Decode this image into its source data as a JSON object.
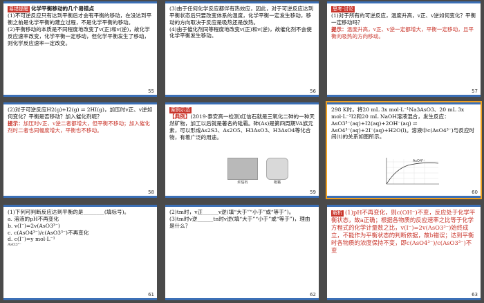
{
  "slides": [
    {
      "number": "55",
      "tag": "易错提醒",
      "title": "化学平衡移动的几个易错点",
      "lines": [
        "(1)不可逆反应只有达到平衡后才会有平衡的移动，在没达到平衡之前是化学平衡的建立过程，不是化学平衡的移动。",
        "(2)平衡移动的本质是不同程度地改变了v(正)和v(逆)，故化学反应速率改变，化学平衡一定移动，但化学平衡发生了移动，则化学反应速率一定改变。"
      ]
    },
    {
      "number": "56",
      "lines": [
        "(3)由于任何化学反应都伴有热效应，因此，对于可逆反应达到平衡状态后只要改变体系的温度，化学平衡一定发生移动，移动的方向取决于反应是吸热还是放热。",
        "(4)由于催化剂同等程度地改变v(正)和v(逆)，故催化剂不会使化学平衡发生移动。"
      ]
    },
    {
      "number": "57",
      "tag": "思考·讨论",
      "q": "(1)对于所有的可逆反应，温度升高，v正、v逆如何变化？平衡一定移动吗？",
      "hint_label": "提示：",
      "a": "温度升高，v正、v逆一定都增大，平衡一定移动，且平衡向吸热的方向移动。"
    },
    {
      "number": "58",
      "q": "(2)对于可逆反应H2(g)+I2(g) ⇌ 2HI(g)，加压时v正、v逆如何变化？平衡是否移动？加入催化剂呢？",
      "hint_label": "提示：",
      "a": "加压时v正、v逆二者都增大，但平衡不移动；加入催化剂时二者也同幅度增大，平衡也不移动。"
    },
    {
      "number": "59",
      "tag": "案例示范",
      "case_label": "【典例】",
      "text": "(2019·泰安高一检测)红信石就是三氧化二砷的一种天然矿物，加工以后就是著名的砒霜。砷(As)是第四周期VA族元素，可以形成As2S3、As2O5、H3AsO3、H3AsO4等化合物，有着广泛的用途。",
      "cap1": "红信石",
      "cap2": "砒霜"
    },
    {
      "number": "60",
      "text": "298 K时，将20 mL 3x mol·L⁻¹Na3AsO3、20 mL 3x mol·L⁻¹I2和20 mL NaOH溶液混合，发生反应：AsO3³⁻(aq)+I2(aq)+2OH⁻(aq) ⇌ AsO4³⁻(aq)+2I⁻(aq)+H2O(l)。溶液中c(AsO4³⁻)与反应时间(t)的关系如图所示。",
      "chart_label": "AsO4³⁻"
    },
    {
      "number": "61",
      "q": "(1)下列可判断反应达到平衡的是________(填标号)。",
      "opts": [
        "a. 溶液的pH不再变化",
        "b. v(I⁻)=2v(AsO3³⁻)",
        "c. c(AsO4³⁻)/c(AsO3³⁻)不再变化",
        "d. c(I⁻)=y mol·L⁻¹"
      ],
      "sub": "AsO3³⁻"
    },
    {
      "number": "62",
      "lines": [
        "(2)tm时，v正______v逆(填“大于”“小于”或“等于”)。",
        "(3)tm时v逆______tn时v逆(填“大于”“小于”或“等于”)，理由是什么？"
      ]
    },
    {
      "number": "63",
      "tag": "解析",
      "text": "(1)pH不再变化，则c(OH⁻)不变，反应处于化学平衡状态，故a正确；根据各物质的反应速率之比等于化学方程式的化学计量数之比，v(I⁻)=2v(AsO3³⁻)始终成立，不能作为平衡状态的判断依据，故b错误；达到平衡时各物质的浓度保持不变，即c(AsO4³⁻)/c(AsO3³⁻)不变"
    }
  ]
}
